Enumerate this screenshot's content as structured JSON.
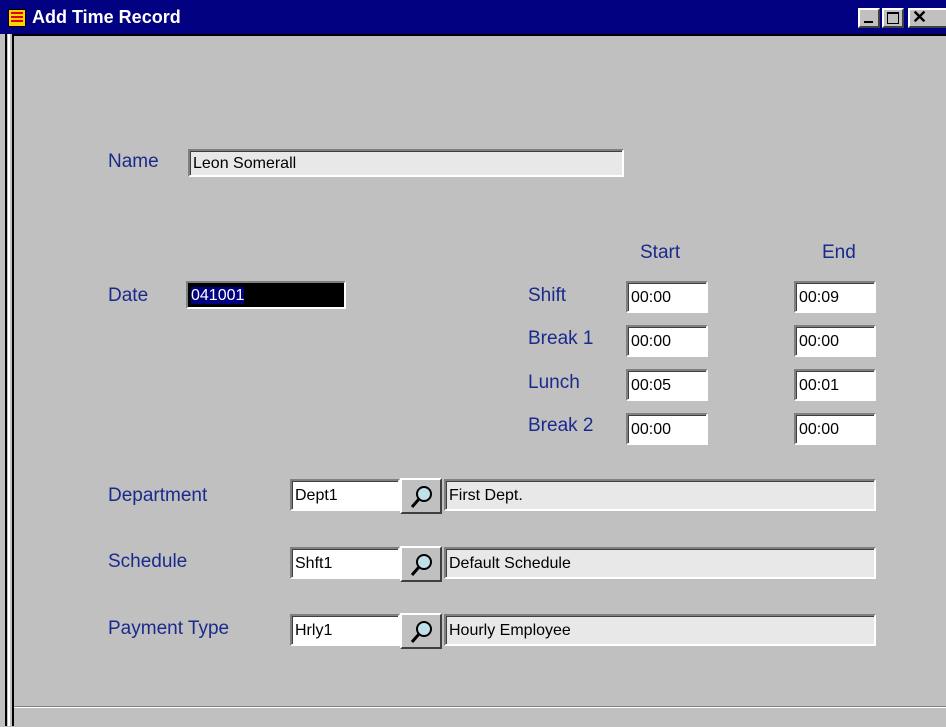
{
  "window": {
    "title": "Add Time Record"
  },
  "form": {
    "name_label": "Name",
    "name_value": "Leon  Somerall",
    "date_label": "Date",
    "date_value": "041001",
    "start_header": "Start",
    "end_header": "End",
    "times": [
      {
        "label": "Shift",
        "start": "00:00",
        "end": "00:09"
      },
      {
        "label": "Break 1",
        "start": "00:00",
        "end": "00:00"
      },
      {
        "label": "Lunch",
        "start": "00:05",
        "end": "00:01"
      },
      {
        "label": "Break 2",
        "start": "00:00",
        "end": "00:00"
      }
    ],
    "lookups": [
      {
        "label": "Department",
        "code": "Dept1",
        "description": "First Dept."
      },
      {
        "label": "Schedule",
        "code": "Shft1",
        "description": "Default Schedule"
      },
      {
        "label": "Payment Type",
        "code": "Hrly1",
        "description": "Hourly Employee"
      }
    ]
  },
  "icons": {
    "app": "app-grid-icon",
    "minimize": "minimize-icon",
    "maximize": "maximize-icon",
    "close": "close-icon",
    "lookup": "magnifier-icon"
  }
}
